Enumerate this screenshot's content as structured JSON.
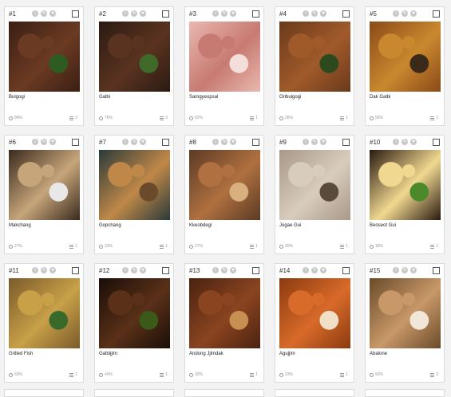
{
  "colors": {
    "card_bg": "#ffffff",
    "page_bg": "#f3f3f3",
    "muted": "#999999"
  },
  "icons": {
    "info": "info-icon",
    "edit": "pencil-icon",
    "like": "heart-icon",
    "percent": "pie-icon",
    "count": "list-icon"
  },
  "dishes": [
    {
      "num": "#1",
      "name": "Bulgogi",
      "pct": "84%",
      "count": "3",
      "palette": [
        "#3a1f14",
        "#6b3a22",
        "#2e5b1f"
      ]
    },
    {
      "num": "#2",
      "name": "Galbi",
      "pct": "76%",
      "count": "3",
      "palette": [
        "#2b1a12",
        "#5a3320",
        "#3f6a2a"
      ]
    },
    {
      "num": "#3",
      "name": "Samgyeopsal",
      "pct": "62%",
      "count": "1",
      "palette": [
        "#e9b8b0",
        "#c77a72",
        "#f3ded9"
      ]
    },
    {
      "num": "#4",
      "name": "Oribulgogi",
      "pct": "28%",
      "count": "1",
      "palette": [
        "#6a3a1c",
        "#a05a2a",
        "#2d4a1e"
      ]
    },
    {
      "num": "#5",
      "name": "Dak Galbi",
      "pct": "56%",
      "count": "1",
      "palette": [
        "#8a4a18",
        "#c9882e",
        "#3b2a1a"
      ]
    },
    {
      "num": "#6",
      "name": "Makchang",
      "pct": "27%",
      "count": "1",
      "palette": [
        "#3a2a1e",
        "#c6a57a",
        "#e8e8e8"
      ]
    },
    {
      "num": "#7",
      "name": "Gopchang",
      "pct": "23%",
      "count": "1",
      "palette": [
        "#2a3a3a",
        "#c08848",
        "#6a4a2a"
      ]
    },
    {
      "num": "#8",
      "name": "Kkeobdegi",
      "pct": "27%",
      "count": "1",
      "palette": [
        "#5a3a24",
        "#b07040",
        "#d8b080"
      ]
    },
    {
      "num": "#9",
      "name": "Jogae Gui",
      "pct": "20%",
      "count": "1",
      "palette": [
        "#a89888",
        "#d8ccbc",
        "#5a4a3a"
      ]
    },
    {
      "num": "#10",
      "name": "Beoseot Gui",
      "pct": "18%",
      "count": "1",
      "palette": [
        "#2a1a10",
        "#f0d890",
        "#4a8a2a"
      ]
    },
    {
      "num": "#11",
      "name": "Grilled Fish",
      "pct": "60%",
      "count": "1",
      "palette": [
        "#7a5a2a",
        "#c8a048",
        "#3a6a2a"
      ]
    },
    {
      "num": "#12",
      "name": "Galbijjim",
      "pct": "40%",
      "count": "1",
      "palette": [
        "#1a0e08",
        "#5a3018",
        "#3a5a1a"
      ]
    },
    {
      "num": "#13",
      "name": "Andong Jjimdak",
      "pct": "30%",
      "count": "1",
      "palette": [
        "#4a2210",
        "#8a4420",
        "#c89050"
      ]
    },
    {
      "num": "#14",
      "name": "Agujjim",
      "pct": "23%",
      "count": "1",
      "palette": [
        "#8a3a10",
        "#d86a2a",
        "#f0e0c8"
      ]
    },
    {
      "num": "#15",
      "name": "Abalone",
      "pct": "50%",
      "count": "3",
      "palette": [
        "#6a4a2a",
        "#c89868",
        "#f0e6da"
      ]
    }
  ]
}
